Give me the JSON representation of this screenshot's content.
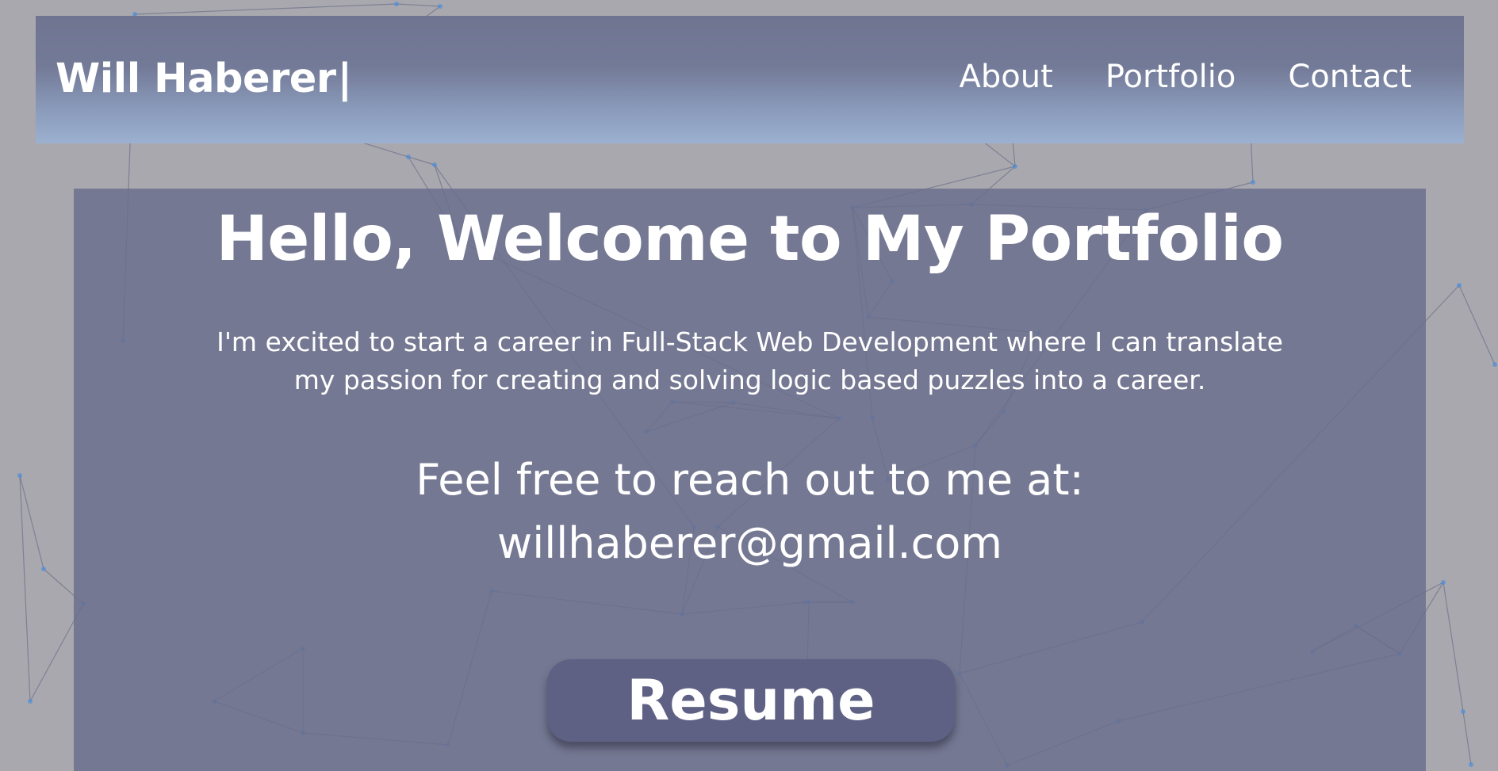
{
  "header": {
    "brand": "Will Haberer",
    "cursor": "|",
    "nav": [
      {
        "label": "About"
      },
      {
        "label": "Portfolio"
      },
      {
        "label": "Contact"
      }
    ]
  },
  "hero": {
    "title": "Hello, Welcome to My Portfolio",
    "intro": "I'm excited to start a career in Full-Stack Web Development where I can translate my passion for creating and solving logic based puzzles into a career.",
    "contact_prompt": "Feel free to reach out to me at:",
    "email": "willhaberer@gmail.com",
    "resume_label": "Resume"
  },
  "colors": {
    "page_background": "#a9a8ae",
    "header_gradient_top": "#6f7591",
    "header_gradient_bottom": "#9cb0cf",
    "panel_background": "#696e8c",
    "button_background": "#5e6184",
    "network_line": "#5a6080",
    "network_node": "#4f8fd8",
    "text": "#ffffff"
  }
}
